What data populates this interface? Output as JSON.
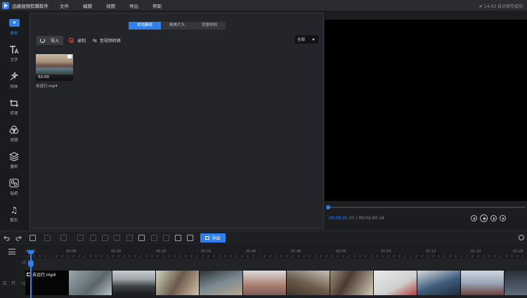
{
  "app": {
    "title": "迅捷视频剪辑软件",
    "menu": [
      "文件",
      "编辑",
      "视图",
      "导出",
      "帮助"
    ],
    "save_status": "14:43 自动保存成功"
  },
  "sidebar": {
    "items": [
      {
        "label": "素材",
        "icon": "media-icon",
        "active": true
      },
      {
        "label": "文字",
        "icon": "text-icon"
      },
      {
        "label": "特效",
        "icon": "effects-icon"
      },
      {
        "label": "转场",
        "icon": "transition-icon"
      },
      {
        "label": "滤镜",
        "icon": "filter-icon"
      },
      {
        "label": "叠附",
        "icon": "overlay-icon"
      },
      {
        "label": "贴纸",
        "icon": "sticker-icon"
      },
      {
        "label": "配乐",
        "icon": "music-icon"
      }
    ]
  },
  "media": {
    "tabs": [
      "本地素材",
      "精美片头",
      "背景样例"
    ],
    "import_label": "导入",
    "record_label": "录制",
    "convert_label": "音视频转换",
    "filter_value": "全部",
    "clip": {
      "name": "去远行.mp4",
      "duration": "02:00"
    }
  },
  "preview": {
    "current_time": "00:00:01.05",
    "separator": " / ",
    "total_time": "00:02:00.14",
    "progress": 0.005
  },
  "edit_toolbar": {
    "export_label": "导出"
  },
  "timeline": {
    "ticks": [
      "00:00",
      "00:08",
      "00:16",
      "00:24",
      "00:32",
      "00:40",
      "00:48",
      "00:56",
      "01:04",
      "01:12",
      "01:20",
      "01:28"
    ],
    "track_clip_name": "去远行.mp4"
  },
  "colors": {
    "accent": "#2f80ed",
    "background": "#1c1d20"
  }
}
